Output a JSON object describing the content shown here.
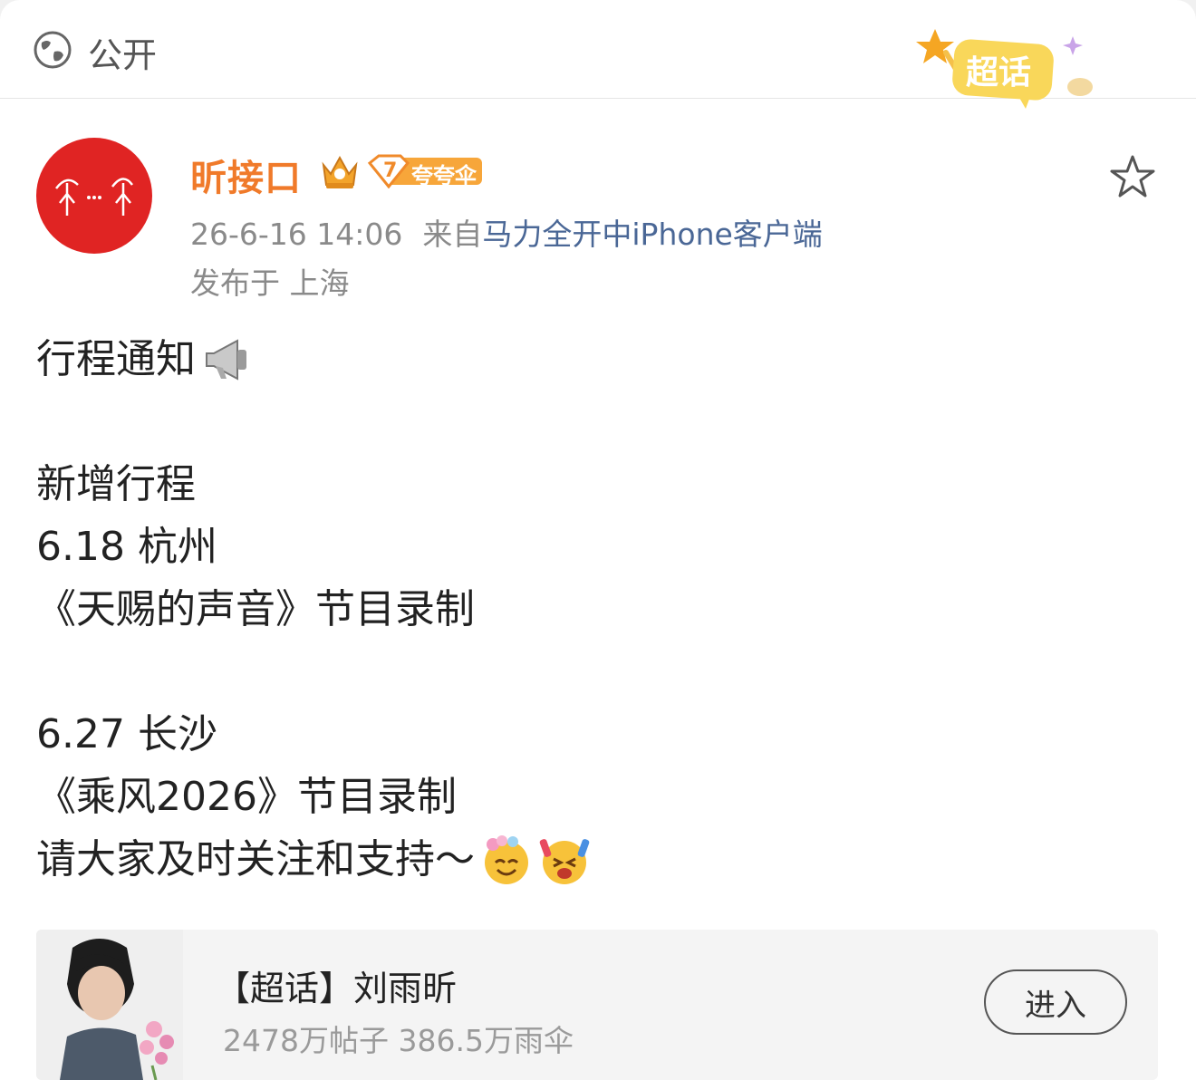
{
  "header": {
    "visibility_label": "公开",
    "badge_text": "超话"
  },
  "author": {
    "name": "昕接口",
    "fan_level": "7",
    "fan_badge_text": "夸夸伞",
    "post_time": "26-6-16 14:06",
    "source_prefix": "来自",
    "source_device": "马力全开中iPhone客户端",
    "location": "发布于 上海"
  },
  "post": {
    "lines": [
      "行程通知",
      "",
      "新增行程",
      "6.18 杭州",
      "《天赐的声音》节目录制",
      "",
      "6.27 长沙",
      "《乘风2026》节目录制",
      "请大家及时关注和支持～"
    ],
    "emojis": [
      "megaphone-icon",
      "flower-smile-emoji",
      "cheer-emoji"
    ]
  },
  "supertopic": {
    "name": "【超话】刘雨昕",
    "stats": "2478万帖子 386.5万雨伞",
    "enter_label": "进入"
  },
  "colors": {
    "name_orange": "#f07a2a",
    "link_blue": "#4a6796",
    "avatar_red": "#e02423"
  }
}
